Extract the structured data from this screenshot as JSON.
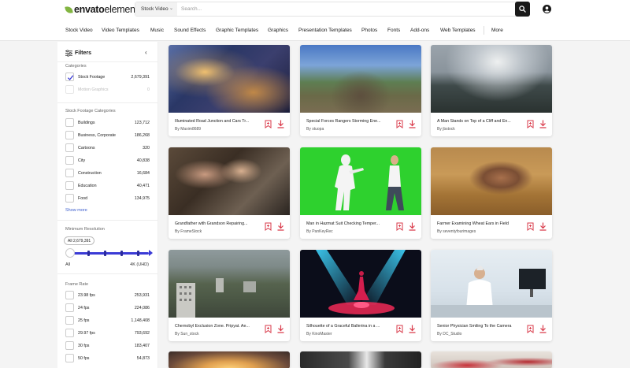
{
  "header": {
    "logo_part1": "envato",
    "logo_part2": "elements",
    "search_category": "Stock Video",
    "search_placeholder": "Search..."
  },
  "nav": [
    "Stock Video",
    "Video Templates",
    "Music",
    "Sound Effects",
    "Graphic Templates",
    "Graphics",
    "Presentation Templates",
    "Photos",
    "Fonts",
    "Add-ons",
    "Web Templates",
    "More"
  ],
  "sidebar": {
    "title": "Filters",
    "categories_heading": "Categories",
    "categories": [
      {
        "label": "Stock Footage",
        "count": "2,679,391",
        "checked": true
      },
      {
        "label": "Motion Graphics",
        "count": "0",
        "disabled": true
      }
    ],
    "footage_heading": "Stock Footage Categories",
    "footage_categories": [
      {
        "label": "Buildings",
        "count": "123,712"
      },
      {
        "label": "Business, Corporate",
        "count": "186,268"
      },
      {
        "label": "Cartoons",
        "count": "320"
      },
      {
        "label": "City",
        "count": "40,838"
      },
      {
        "label": "Construction",
        "count": "16,684"
      },
      {
        "label": "Education",
        "count": "40,471"
      },
      {
        "label": "Food",
        "count": "134,975"
      }
    ],
    "show_more": "Show more",
    "resolution_heading": "Minimum Resolution",
    "resolution_tooltip": "All 2,679,391",
    "resolution_min": "All",
    "resolution_max": "4K (UHD)",
    "frame_rate_heading": "Frame Rate",
    "frame_rates": [
      {
        "label": "23.98 fps",
        "count": "253,931"
      },
      {
        "label": "24 fps",
        "count": "224,086"
      },
      {
        "label": "25 fps",
        "count": "1,148,408"
      },
      {
        "label": "29.97 fps",
        "count": "793,692"
      },
      {
        "label": "30 fps",
        "count": "183,407"
      },
      {
        "label": "50 fps",
        "count": "54,873"
      }
    ]
  },
  "items": [
    {
      "title": "Illuminated Road Junction and Cars Tr...",
      "author": "By Maxim8689"
    },
    {
      "title": "Special Forces Rangers Storming Ene...",
      "author": "By stuopa"
    },
    {
      "title": "A Man Stands on Top of a Cliff and En...",
      "author": "By jbstock"
    },
    {
      "title": "Grandfather with Grandson Repairing...",
      "author": "By FrameStock"
    },
    {
      "title": "Man in Hazmat Suit Checking Temper...",
      "author": "By PanKeyRec"
    },
    {
      "title": "Farmer Examining Wheat Ears in Field",
      "author": "By seventyfourimages"
    },
    {
      "title": "Chernobyl Exclusion Zone. Pripyat. Ae...",
      "author": "By Sun_stock"
    },
    {
      "title": "Silhouette of a Graceful Ballerina in a ...",
      "author": "By KinoMaster"
    },
    {
      "title": "Senior Physician Smiling To the Camera",
      "author": "By DC_Studio"
    }
  ],
  "colors": {
    "brand_green": "#82b541",
    "accent_red": "#d93a4a",
    "slider_blue": "#3b3bd6",
    "link_blue": "#3b5ccc"
  }
}
